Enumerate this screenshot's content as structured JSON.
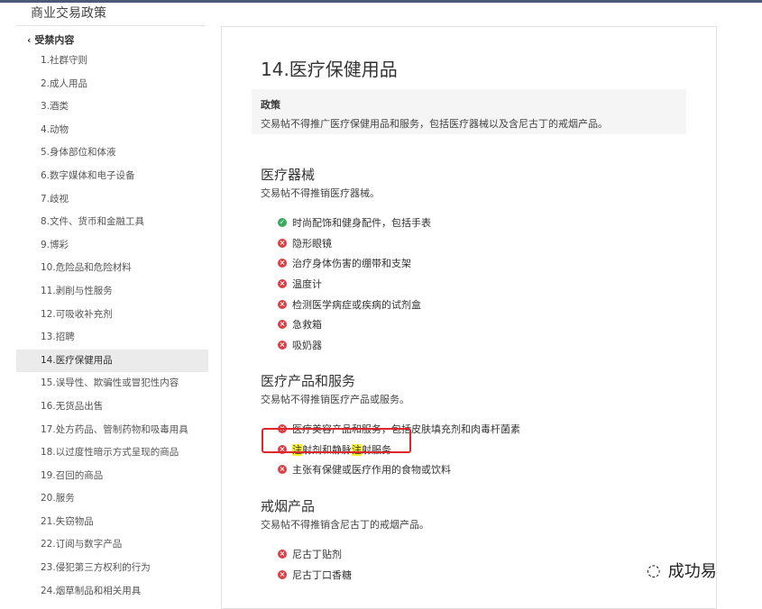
{
  "app": {
    "page_title": "商业交易政策"
  },
  "sidebar": {
    "back_label": "‹ 受禁内容",
    "items": [
      {
        "label": "1.社群守则"
      },
      {
        "label": "2.成人用品"
      },
      {
        "label": "3.酒类"
      },
      {
        "label": "4.动物"
      },
      {
        "label": "5.身体部位和体液"
      },
      {
        "label": "6.数字媒体和电子设备"
      },
      {
        "label": "7.歧视"
      },
      {
        "label": "8.文件、货币和金融工具"
      },
      {
        "label": "9.博彩"
      },
      {
        "label": "10.危险品和危险材料"
      },
      {
        "label": "11.剥削与性服务"
      },
      {
        "label": "12.可吸收补充剂"
      },
      {
        "label": "13.招聘"
      },
      {
        "label": "14.医疗保健用品"
      },
      {
        "label": "15.误导性、欺骗性或冒犯性内容"
      },
      {
        "label": "16.无货品出售"
      },
      {
        "label": "17.处方药品、管制药物和吸毒用具"
      },
      {
        "label": "18.以过度性暗示方式呈现的商品"
      },
      {
        "label": "19.召回的商品"
      },
      {
        "label": "20.服务"
      },
      {
        "label": "21.失窃物品"
      },
      {
        "label": "22.订阅与数字产品"
      },
      {
        "label": "23.侵犯第三方权利的行为"
      },
      {
        "label": "24.烟草制品和相关用具"
      }
    ],
    "active_index": 13
  },
  "content": {
    "title": "14.医疗保健用品",
    "policy_label": "政策",
    "policy_text": "交易帖不得推广医疗保健用品和服务，包括医疗器械以及含尼古丁的戒烟产品。",
    "sections": [
      {
        "title": "医疗器械",
        "desc": "交易帖不得推销医疗器械。",
        "items": [
          {
            "status": "allowed",
            "icon": "check-circle-icon",
            "text": "时尚配饰和健身配件，包括手表"
          },
          {
            "status": "prohibited",
            "icon": "x-circle-icon",
            "text": "隐形眼镜"
          },
          {
            "status": "prohibited",
            "icon": "x-circle-icon",
            "text": "治疗身体伤害的绷带和支架"
          },
          {
            "status": "prohibited",
            "icon": "x-circle-icon",
            "text": "温度计"
          },
          {
            "status": "prohibited",
            "icon": "x-circle-icon",
            "text": "检测医学病症或疾病的试剂盒"
          },
          {
            "status": "prohibited",
            "icon": "x-circle-icon",
            "text": "急救箱"
          },
          {
            "status": "prohibited",
            "icon": "x-circle-icon",
            "text": "吸奶器"
          }
        ]
      },
      {
        "title": "医疗产品和服务",
        "desc": "交易帖不得推销医疗产品或服务。",
        "items": [
          {
            "status": "prohibited",
            "icon": "x-circle-icon",
            "text": "医疗美容产品和服务，包括皮肤填充剂和肉毒杆菌素"
          },
          {
            "status": "prohibited",
            "icon": "x-circle-icon",
            "text": "注射剂和静脉注射服务",
            "parts": [
              "注",
              "射剂和静脉",
              "注",
              "射服务"
            ]
          },
          {
            "status": "prohibited",
            "icon": "x-circle-icon",
            "text": "主张有保健或医疗作用的食物或饮料"
          }
        ]
      },
      {
        "title": "戒烟产品",
        "desc": "交易帖不得推销含尼古丁的戒烟产品。",
        "items": [
          {
            "status": "prohibited",
            "icon": "x-circle-icon",
            "text": "尼古丁贴剂"
          },
          {
            "status": "prohibited",
            "icon": "x-circle-icon",
            "text": "尼古丁口香糖"
          }
        ]
      }
    ]
  },
  "watermark": {
    "icon": "wechat-icon",
    "text": "成功易"
  },
  "colors": {
    "allowed": "#3aaa5c",
    "prohibited": "#d94045",
    "highlight": "#f5ec3c",
    "annotation_box": "#e0262b"
  }
}
